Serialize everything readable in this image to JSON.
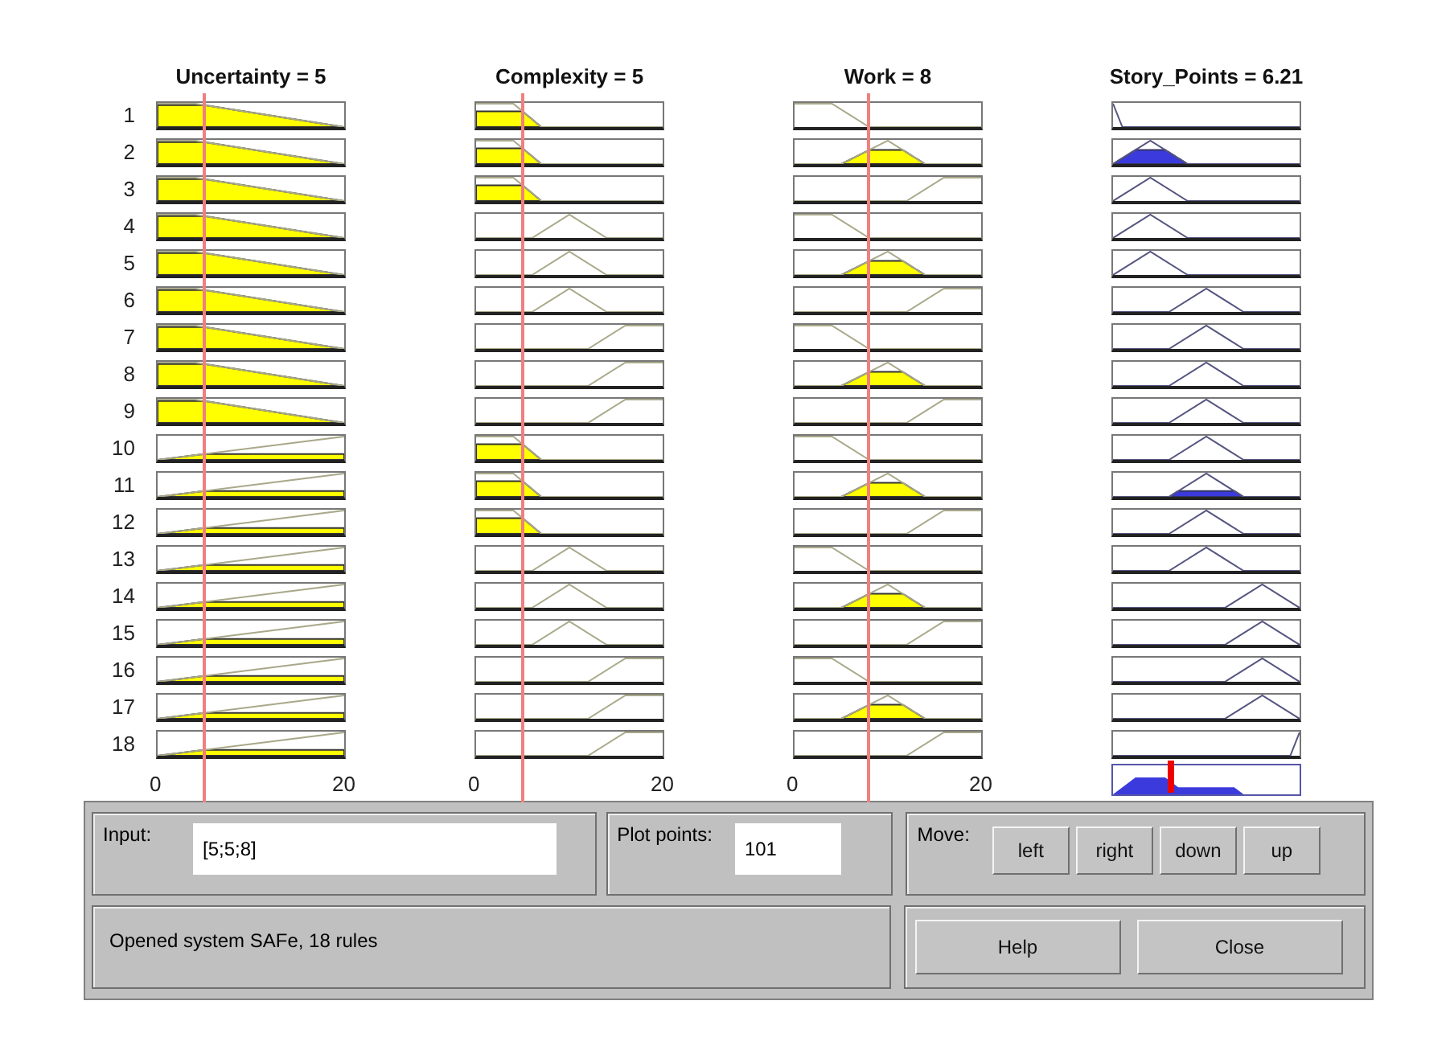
{
  "variables": [
    {
      "kind": "input",
      "title": "Uncertainty = 5",
      "level": 0.25,
      "ticks": [
        "0",
        "20"
      ]
    },
    {
      "kind": "input",
      "title": "Complexity = 5",
      "level": 0.25,
      "ticks": [
        "0",
        "20"
      ]
    },
    {
      "kind": "input",
      "title": "Work = 8",
      "level": 0.4,
      "ticks": [
        "0",
        "20"
      ]
    },
    {
      "kind": "output",
      "title": "Story_Points = 6.21",
      "level": 0.3105
    }
  ],
  "rules": [
    {
      "number": "1",
      "cells": [
        {
          "kind": "low"
        },
        {
          "kind": "low"
        },
        {
          "kind": "low"
        },
        {
          "kind": "very_low"
        }
      ]
    },
    {
      "number": "2",
      "cells": [
        {
          "kind": "low"
        },
        {
          "kind": "low"
        },
        {
          "kind": "medium"
        },
        {
          "kind": "low"
        }
      ]
    },
    {
      "number": "3",
      "cells": [
        {
          "kind": "low"
        },
        {
          "kind": "low"
        },
        {
          "kind": "high"
        },
        {
          "kind": "low"
        }
      ]
    },
    {
      "number": "4",
      "cells": [
        {
          "kind": "low"
        },
        {
          "kind": "medium"
        },
        {
          "kind": "low"
        },
        {
          "kind": "low"
        }
      ]
    },
    {
      "number": "5",
      "cells": [
        {
          "kind": "low"
        },
        {
          "kind": "medium"
        },
        {
          "kind": "medium"
        },
        {
          "kind": "low"
        }
      ]
    },
    {
      "number": "6",
      "cells": [
        {
          "kind": "low"
        },
        {
          "kind": "medium"
        },
        {
          "kind": "high"
        },
        {
          "kind": "medium"
        }
      ]
    },
    {
      "number": "7",
      "cells": [
        {
          "kind": "low"
        },
        {
          "kind": "high"
        },
        {
          "kind": "low"
        },
        {
          "kind": "medium"
        }
      ]
    },
    {
      "number": "8",
      "cells": [
        {
          "kind": "low"
        },
        {
          "kind": "high"
        },
        {
          "kind": "medium"
        },
        {
          "kind": "medium"
        }
      ]
    },
    {
      "number": "9",
      "cells": [
        {
          "kind": "low"
        },
        {
          "kind": "high"
        },
        {
          "kind": "high"
        },
        {
          "kind": "medium"
        }
      ]
    },
    {
      "number": "10",
      "cells": [
        {
          "kind": "high"
        },
        {
          "kind": "low"
        },
        {
          "kind": "low"
        },
        {
          "kind": "medium"
        }
      ]
    },
    {
      "number": "11",
      "cells": [
        {
          "kind": "high"
        },
        {
          "kind": "low"
        },
        {
          "kind": "medium"
        },
        {
          "kind": "medium"
        }
      ]
    },
    {
      "number": "12",
      "cells": [
        {
          "kind": "high"
        },
        {
          "kind": "low"
        },
        {
          "kind": "high"
        },
        {
          "kind": "medium"
        }
      ]
    },
    {
      "number": "13",
      "cells": [
        {
          "kind": "high"
        },
        {
          "kind": "medium"
        },
        {
          "kind": "low"
        },
        {
          "kind": "medium"
        }
      ]
    },
    {
      "number": "14",
      "cells": [
        {
          "kind": "high"
        },
        {
          "kind": "medium"
        },
        {
          "kind": "medium"
        },
        {
          "kind": "high"
        }
      ]
    },
    {
      "number": "15",
      "cells": [
        {
          "kind": "high"
        },
        {
          "kind": "medium"
        },
        {
          "kind": "high"
        },
        {
          "kind": "high"
        }
      ]
    },
    {
      "number": "16",
      "cells": [
        {
          "kind": "high"
        },
        {
          "kind": "high"
        },
        {
          "kind": "low"
        },
        {
          "kind": "high"
        }
      ]
    },
    {
      "number": "17",
      "cells": [
        {
          "kind": "high"
        },
        {
          "kind": "high"
        },
        {
          "kind": "medium"
        },
        {
          "kind": "high"
        }
      ]
    },
    {
      "number": "18",
      "cells": [
        {
          "kind": "high"
        },
        {
          "kind": "high"
        },
        {
          "kind": "high"
        },
        {
          "kind": "very_high"
        }
      ]
    }
  ],
  "panel": {
    "input_label": "Input:",
    "input_value": "[5;5;8]",
    "plot_points_label": "Plot points:",
    "plot_points_value": "101",
    "move_label": "Move:",
    "move_buttons": [
      "left",
      "right",
      "down",
      "up"
    ],
    "status": "Opened system SAFe, 18 rules",
    "buttons": [
      "Help",
      "Close"
    ]
  }
}
